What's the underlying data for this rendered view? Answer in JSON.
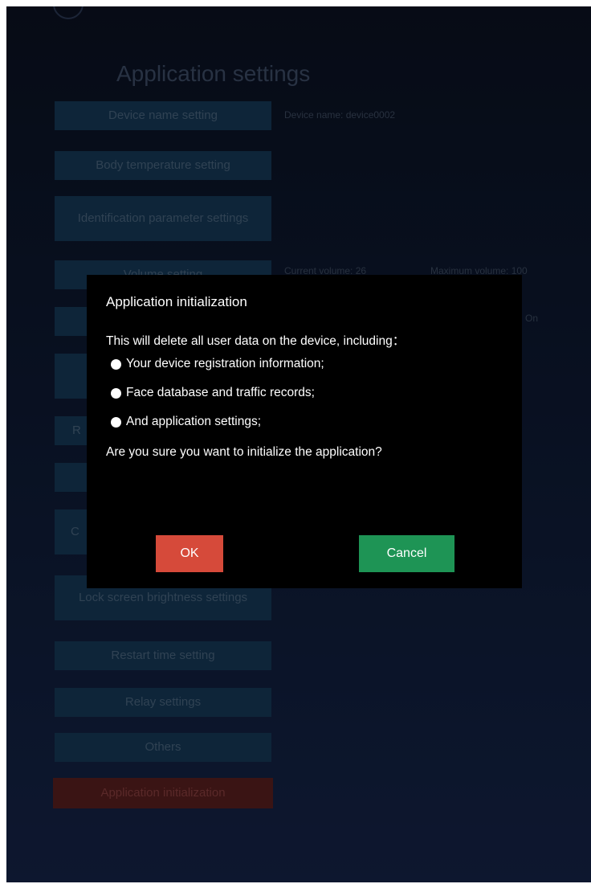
{
  "page": {
    "title": "Application settings"
  },
  "menu": {
    "device_name": "Device name setting",
    "body_temperature": "Body temperature setting",
    "identification_params": "Identification parameter settings",
    "volume": "Volume setting",
    "lock_screen_brightness": "Lock screen brightness settings",
    "restart_time": "Restart time setting",
    "relay": "Relay settings",
    "others": "Others",
    "app_init": "Application initialization",
    "peek_letter_r": "R",
    "peek_letters_c": "C"
  },
  "info": {
    "device_name": "Device name: device0002",
    "current_volume": "Current volume: 26",
    "maximum_volume": "Maximum volume: 100",
    "on_state": "On"
  },
  "dialog": {
    "title": "Application initialization",
    "message": "This will delete all user data on the device, including：",
    "items": [
      "Your device registration information;",
      "Face database and traffic records;",
      "And application settings;"
    ],
    "question": "Are you sure you want to initialize the application?",
    "ok_label": "OK",
    "cancel_label": "Cancel"
  },
  "colors": {
    "ok": "#d64a3a",
    "cancel": "#1e9455",
    "menu_button": "#163a58",
    "danger_button": "#5a1f1f"
  }
}
